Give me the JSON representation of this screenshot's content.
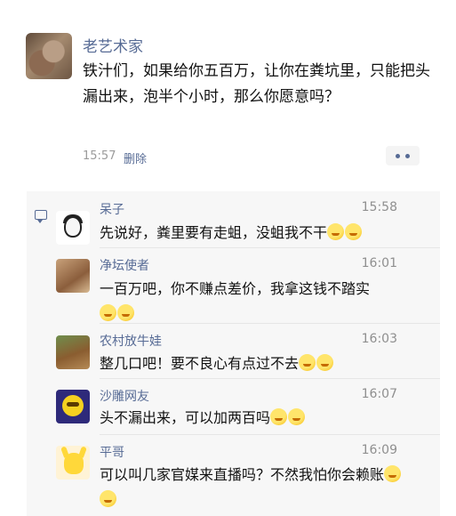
{
  "post": {
    "author": "老艺术家",
    "text": "铁汁们，如果给你五百万，让你在粪坑里，只能把头漏出来，泡半个小时，那么你愿意吗？",
    "time": "15:57",
    "delete_label": "删除"
  },
  "comments": [
    {
      "name": "呆子",
      "time": "15:58",
      "text": "先说好，粪里要有走蛆，没蛆我不干",
      "avatar_icon": "cartoon-avatar",
      "emoji_icon": "laugh-emoji"
    },
    {
      "name": "净坛使者",
      "time": "16:01",
      "text": "一百万吧，你不赚点差价，我拿这钱不踏实",
      "avatar_icon": "dog-photo-avatar",
      "emoji_icon": "smirk-emoji"
    },
    {
      "name": "农村放牛娃",
      "time": "16:03",
      "text": "整几口吧！要不良心有点过不去",
      "avatar_icon": "cow-photo-avatar",
      "emoji_icon": "smirk-emoji"
    },
    {
      "name": "沙雕网友",
      "time": "16:07",
      "text": "头不漏出来，可以加两百吗",
      "avatar_icon": "emoji-face-avatar",
      "emoji_icon": "dizzy-emoji"
    },
    {
      "name": "平哥",
      "time": "16:09",
      "text": "可以叫几家官媒来直播吗？不然我怕你会赖账",
      "avatar_icon": "pikachu-avatar",
      "emoji_icon": "smirk-emoji"
    }
  ],
  "colors": {
    "link": "#576b95",
    "comment_bg": "#f7f7f7",
    "meta": "#9b9b9b"
  }
}
